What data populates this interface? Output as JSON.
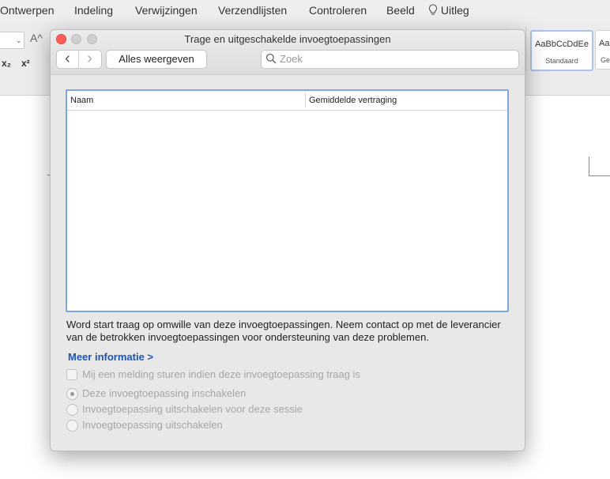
{
  "ribbon": {
    "tabs": [
      "Ontwerpen",
      "Indeling",
      "Verwijzingen",
      "Verzendlijsten",
      "Controleren",
      "Beeld",
      "Uitleg"
    ],
    "font_size_icon": "A^",
    "subscript_label": "x₂",
    "superscript_label": "x²",
    "styles": [
      {
        "preview": "AaBbCcDdEe",
        "name": "Standaard"
      },
      {
        "preview": "AaBb",
        "name": "Ge"
      }
    ]
  },
  "dialog": {
    "title": "Trage en uitgeschakelde invoegtoepassingen",
    "back_icon": "‹",
    "forward_icon": "›",
    "show_all_label": "Alles weergeven",
    "search_placeholder": "Zoek",
    "table": {
      "columns": [
        "Naam",
        "Gemiddelde vertraging"
      ],
      "rows": []
    },
    "description": "Word start traag op omwille van deze invoegtoepassingen. Neem contact op met de leverancier van de betrokken invoegtoepassingen voor ondersteuning van deze problemen.",
    "more_info_link": "Meer informatie >",
    "notify_checkbox_label": "Mij een melding sturen indien deze invoegtoepassing traag is",
    "radio_options": [
      {
        "label": "Deze invoegtoepassing inschakelen",
        "selected": true
      },
      {
        "label": "Invoegtoepassing uitschakelen voor deze sessie",
        "selected": false
      },
      {
        "label": "Invoegtoepassing uitschakelen",
        "selected": false
      }
    ]
  },
  "colors": {
    "accent_link": "#1a55b8",
    "table_focus_border": "#7ea6df",
    "close_button": "#ff5f57"
  }
}
